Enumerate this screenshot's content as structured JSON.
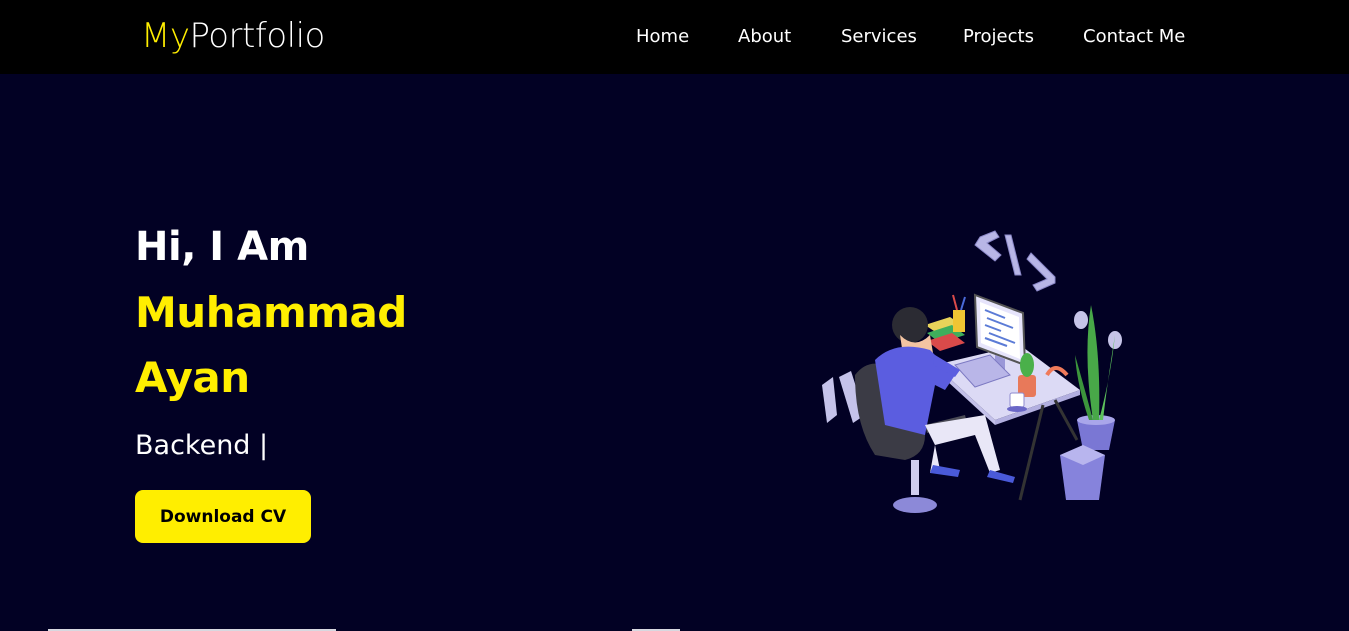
{
  "nav": {
    "logo_prefix": "My",
    "logo_suffix": "Portfolio",
    "links": [
      "Home",
      "About",
      "Services",
      "Projects",
      "Contact Me"
    ]
  },
  "hero": {
    "greeting": "Hi, I Am",
    "name_line1": "Muhammad",
    "name_line2": "Ayan",
    "role": "Backend |",
    "cv_button": "Download CV"
  },
  "colors": {
    "accent": "#ffee00",
    "background": "#020124",
    "navbar": "#000000",
    "text": "#ffffff"
  },
  "icons": [
    "code-brackets-icon",
    "developer-desk-illustration"
  ]
}
